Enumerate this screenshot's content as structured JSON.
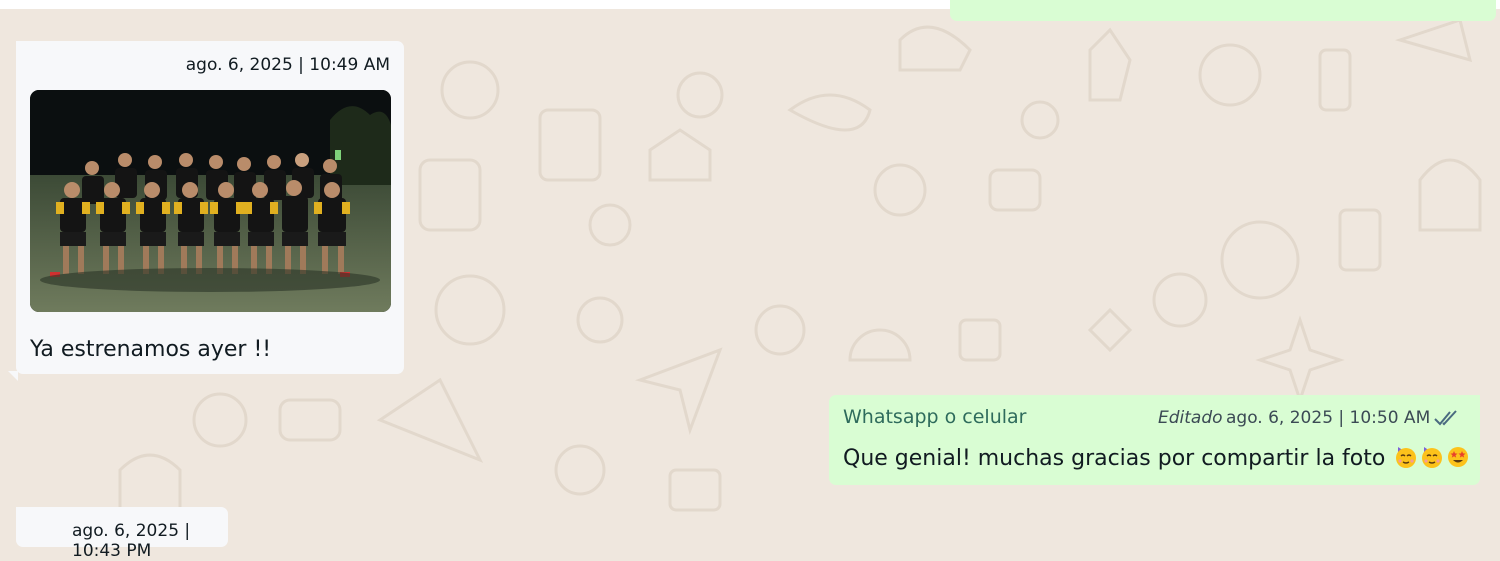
{
  "colors": {
    "background": "#efe7de",
    "incoming_bubble": "#f7f8fa",
    "outgoing_bubble": "#d9fdd3",
    "sender_name": "#2e6b5c",
    "read_ticks": "#4a6a80"
  },
  "messages": [
    {
      "direction": "incoming",
      "timestamp": "ago. 6, 2025 | 10:49 AM",
      "has_photo": true,
      "text": "Ya estrenamos ayer !!"
    },
    {
      "direction": "outgoing",
      "sender": "Whatsapp o celular",
      "edited_label": "Editado",
      "timestamp": "ago. 6, 2025 | 10:50 AM",
      "status_icon": "double-check-icon",
      "text": "Que genial! muchas gracias por compartir la foto",
      "emojis": [
        "party-face-emoji",
        "party-face-emoji",
        "star-struck-emoji"
      ]
    },
    {
      "direction": "incoming",
      "timestamp": "ago. 6, 2025 | 10:43 PM"
    }
  ]
}
